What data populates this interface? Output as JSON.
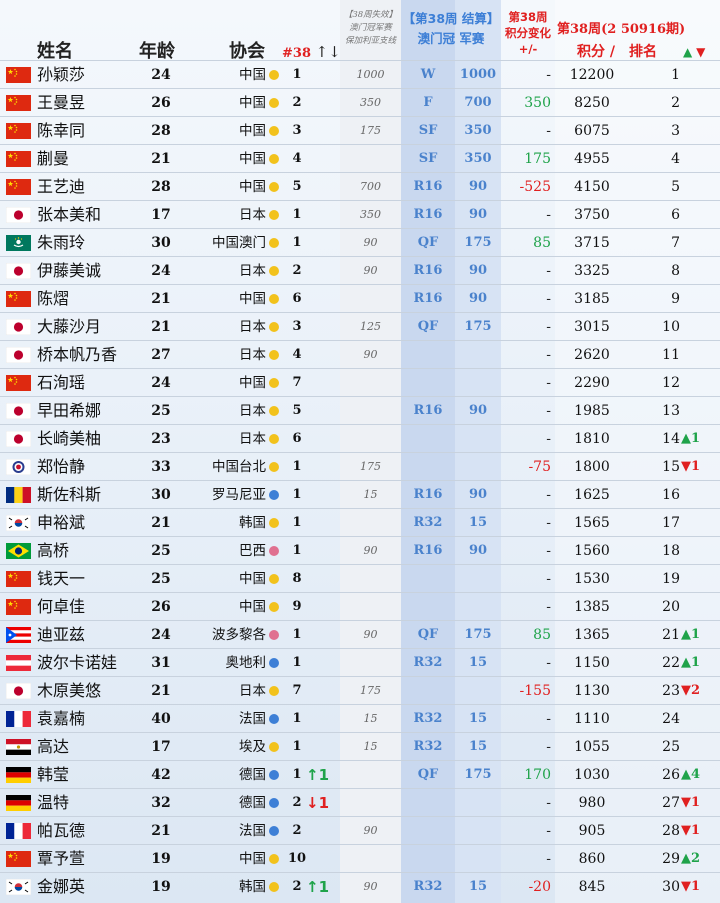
{
  "header": {
    "name": "姓名",
    "age": "年龄",
    "assoc": "协会",
    "wk38": "#38",
    "wk38_arrows": "↑↓",
    "lost_l1": "【38周失效】",
    "lost_l2": "澳门冠军赛",
    "lost_l3": "保加利亚支线",
    "result_l1": "【第38周 结算】",
    "result_l2": "澳门冠 军赛",
    "change_l1": "第38周",
    "change_l2": "积分变化",
    "change_l3": "+/-",
    "new_title": "第38周(2 50916期)",
    "new_pts": "积分 /",
    "new_rank": "排名",
    "updown_up": "▲",
    "updown_dn": "▼"
  },
  "colors": {
    "china_dot": "#f2c21c",
    "japan_dot": "#f2c21c",
    "europe_dot": "#3d7fd6",
    "america_dot": "#e07090",
    "asia_dot": "#3d7fd6",
    "green": "#1fa34a",
    "red": "#e02020",
    "blue_text": "#4a82cc"
  },
  "rows": [
    {
      "flag": "cn",
      "name": "孙颖莎",
      "age": "24",
      "assoc": "中国",
      "dot": "yellow",
      "r38": "1",
      "mv38": "",
      "lost": "1000",
      "stage": "W",
      "stpts": "1000",
      "chg": "-",
      "pts": "12200",
      "rank": "1",
      "rmv": ""
    },
    {
      "flag": "cn",
      "name": "王曼昱",
      "age": "26",
      "assoc": "中国",
      "dot": "yellow",
      "r38": "2",
      "mv38": "",
      "lost": "350",
      "stage": "F",
      "stpts": "700",
      "chg": "350",
      "pts": "8250",
      "rank": "2",
      "rmv": ""
    },
    {
      "flag": "cn",
      "name": "陈幸同",
      "age": "28",
      "assoc": "中国",
      "dot": "yellow",
      "r38": "3",
      "mv38": "",
      "lost": "175",
      "stage": "SF",
      "stpts": "350",
      "chg": "-",
      "pts": "6075",
      "rank": "3",
      "rmv": ""
    },
    {
      "flag": "cn",
      "name": "蒯曼",
      "age": "21",
      "assoc": "中国",
      "dot": "yellow",
      "r38": "4",
      "mv38": "",
      "lost": "",
      "stage": "SF",
      "stpts": "350",
      "chg": "175",
      "pts": "4955",
      "rank": "4",
      "rmv": ""
    },
    {
      "flag": "cn",
      "name": "王艺迪",
      "age": "28",
      "assoc": "中国",
      "dot": "yellow",
      "r38": "5",
      "mv38": "",
      "lost": "700",
      "stage": "R16",
      "stpts": "90",
      "chg": "-525",
      "pts": "4150",
      "rank": "5",
      "rmv": ""
    },
    {
      "flag": "jp",
      "name": "张本美和",
      "age": "17",
      "assoc": "日本",
      "dot": "yellow",
      "r38": "1",
      "mv38": "",
      "lost": "350",
      "stage": "R16",
      "stpts": "90",
      "chg": "-",
      "pts": "3750",
      "rank": "6",
      "rmv": ""
    },
    {
      "flag": "mo",
      "name": "朱雨玲",
      "age": "30",
      "assoc": "中国澳门",
      "dot": "yellow",
      "r38": "1",
      "mv38": "",
      "lost": "90",
      "stage": "QF",
      "stpts": "175",
      "chg": "85",
      "pts": "3715",
      "rank": "7",
      "rmv": ""
    },
    {
      "flag": "jp",
      "name": "伊藤美诚",
      "age": "24",
      "assoc": "日本",
      "dot": "yellow",
      "r38": "2",
      "mv38": "",
      "lost": "90",
      "stage": "R16",
      "stpts": "90",
      "chg": "-",
      "pts": "3325",
      "rank": "8",
      "rmv": ""
    },
    {
      "flag": "cn",
      "name": "陈熠",
      "age": "21",
      "assoc": "中国",
      "dot": "yellow",
      "r38": "6",
      "mv38": "",
      "lost": "",
      "stage": "R16",
      "stpts": "90",
      "chg": "-",
      "pts": "3185",
      "rank": "9",
      "rmv": ""
    },
    {
      "flag": "jp",
      "name": "大藤沙月",
      "age": "21",
      "assoc": "日本",
      "dot": "yellow",
      "r38": "3",
      "mv38": "",
      "lost": "125",
      "stage": "QF",
      "stpts": "175",
      "chg": "-",
      "pts": "3015",
      "rank": "10",
      "rmv": ""
    },
    {
      "flag": "jp",
      "name": "桥本帆乃香",
      "age": "27",
      "assoc": "日本",
      "dot": "yellow",
      "r38": "4",
      "mv38": "",
      "lost": "90",
      "stage": "",
      "stpts": "",
      "chg": "-",
      "pts": "2620",
      "rank": "11",
      "rmv": ""
    },
    {
      "flag": "cn",
      "name": "石洵瑶",
      "age": "24",
      "assoc": "中国",
      "dot": "yellow",
      "r38": "7",
      "mv38": "",
      "lost": "",
      "stage": "",
      "stpts": "",
      "chg": "-",
      "pts": "2290",
      "rank": "12",
      "rmv": ""
    },
    {
      "flag": "jp",
      "name": "早田希娜",
      "age": "25",
      "assoc": "日本",
      "dot": "yellow",
      "r38": "5",
      "mv38": "",
      "lost": "",
      "stage": "R16",
      "stpts": "90",
      "chg": "-",
      "pts": "1985",
      "rank": "13",
      "rmv": ""
    },
    {
      "flag": "jp",
      "name": "长崎美柚",
      "age": "23",
      "assoc": "日本",
      "dot": "yellow",
      "r38": "6",
      "mv38": "",
      "lost": "",
      "stage": "",
      "stpts": "",
      "chg": "-",
      "pts": "1810",
      "rank": "14",
      "rmv": "▲1"
    },
    {
      "flag": "tw",
      "name": "郑怡静",
      "age": "33",
      "assoc": "中国台北",
      "dot": "yellow",
      "r38": "1",
      "mv38": "",
      "lost": "175",
      "stage": "",
      "stpts": "",
      "chg": "-75",
      "pts": "1800",
      "rank": "15",
      "rmv": "▼1"
    },
    {
      "flag": "ro",
      "name": "斯佐科斯",
      "age": "30",
      "assoc": "罗马尼亚",
      "dot": "blue",
      "r38": "1",
      "mv38": "",
      "lost": "15",
      "stage": "R16",
      "stpts": "90",
      "chg": "-",
      "pts": "1625",
      "rank": "16",
      "rmv": ""
    },
    {
      "flag": "kr",
      "name": "申裕斌",
      "age": "21",
      "assoc": "韩国",
      "dot": "yellow",
      "r38": "1",
      "mv38": "",
      "lost": "",
      "stage": "R32",
      "stpts": "15",
      "chg": "-",
      "pts": "1565",
      "rank": "17",
      "rmv": ""
    },
    {
      "flag": "br",
      "name": "高桥",
      "age": "25",
      "assoc": "巴西",
      "dot": "pink",
      "r38": "1",
      "mv38": "",
      "lost": "90",
      "stage": "R16",
      "stpts": "90",
      "chg": "-",
      "pts": "1560",
      "rank": "18",
      "rmv": ""
    },
    {
      "flag": "cn",
      "name": "钱天一",
      "age": "25",
      "assoc": "中国",
      "dot": "yellow",
      "r38": "8",
      "mv38": "",
      "lost": "",
      "stage": "",
      "stpts": "",
      "chg": "-",
      "pts": "1530",
      "rank": "19",
      "rmv": ""
    },
    {
      "flag": "cn",
      "name": "何卓佳",
      "age": "26",
      "assoc": "中国",
      "dot": "yellow",
      "r38": "9",
      "mv38": "",
      "lost": "",
      "stage": "",
      "stpts": "",
      "chg": "-",
      "pts": "1385",
      "rank": "20",
      "rmv": ""
    },
    {
      "flag": "pr",
      "name": "迪亚兹",
      "age": "24",
      "assoc": "波多黎各",
      "dot": "pink",
      "r38": "1",
      "mv38": "",
      "lost": "90",
      "stage": "QF",
      "stpts": "175",
      "chg": "85",
      "pts": "1365",
      "rank": "21",
      "rmv": "▲1"
    },
    {
      "flag": "at",
      "name": "波尔卡诺娃",
      "age": "31",
      "assoc": "奥地利",
      "dot": "blue",
      "r38": "1",
      "mv38": "",
      "lost": "",
      "stage": "R32",
      "stpts": "15",
      "chg": "-",
      "pts": "1150",
      "rank": "22",
      "rmv": "▲1"
    },
    {
      "flag": "jp",
      "name": "木原美悠",
      "age": "21",
      "assoc": "日本",
      "dot": "yellow",
      "r38": "7",
      "mv38": "",
      "lost": "175",
      "stage": "",
      "stpts": "",
      "chg": "-155",
      "pts": "1130",
      "rank": "23",
      "rmv": "▼2"
    },
    {
      "flag": "fr",
      "name": "袁嘉楠",
      "age": "40",
      "assoc": "法国",
      "dot": "blue",
      "r38": "1",
      "mv38": "",
      "lost": "15",
      "stage": "R32",
      "stpts": "15",
      "chg": "-",
      "pts": "1110",
      "rank": "24",
      "rmv": ""
    },
    {
      "flag": "eg",
      "name": "高达",
      "age": "17",
      "assoc": "埃及",
      "dot": "yellow",
      "r38": "1",
      "mv38": "",
      "lost": "15",
      "stage": "R32",
      "stpts": "15",
      "chg": "-",
      "pts": "1055",
      "rank": "25",
      "rmv": ""
    },
    {
      "flag": "de",
      "name": "韩莹",
      "age": "42",
      "assoc": "德国",
      "dot": "blue",
      "r38": "1",
      "mv38": "↑1",
      "lost": "",
      "stage": "QF",
      "stpts": "175",
      "chg": "170",
      "pts": "1030",
      "rank": "26",
      "rmv": "▲4"
    },
    {
      "flag": "de",
      "name": "温特",
      "age": "32",
      "assoc": "德国",
      "dot": "blue",
      "r38": "2",
      "mv38": "↓1",
      "lost": "",
      "stage": "",
      "stpts": "",
      "chg": "-",
      "pts": "980",
      "rank": "27",
      "rmv": "▼1"
    },
    {
      "flag": "fr",
      "name": "帕瓦德",
      "age": "21",
      "assoc": "法国",
      "dot": "blue",
      "r38": "2",
      "mv38": "",
      "lost": "90",
      "stage": "",
      "stpts": "",
      "chg": "-",
      "pts": "905",
      "rank": "28",
      "rmv": "▼1"
    },
    {
      "flag": "cn",
      "name": "覃予萱",
      "age": "19",
      "assoc": "中国",
      "dot": "yellow",
      "r38": "10",
      "mv38": "",
      "lost": "",
      "stage": "",
      "stpts": "",
      "chg": "-",
      "pts": "860",
      "rank": "29",
      "rmv": "▲2"
    },
    {
      "flag": "kr",
      "name": "金娜英",
      "age": "19",
      "assoc": "韩国",
      "dot": "yellow",
      "r38": "2",
      "mv38": "↑1",
      "lost": "90",
      "stage": "R32",
      "stpts": "15",
      "chg": "-20",
      "pts": "845",
      "rank": "30",
      "rmv": "▼1"
    }
  ]
}
